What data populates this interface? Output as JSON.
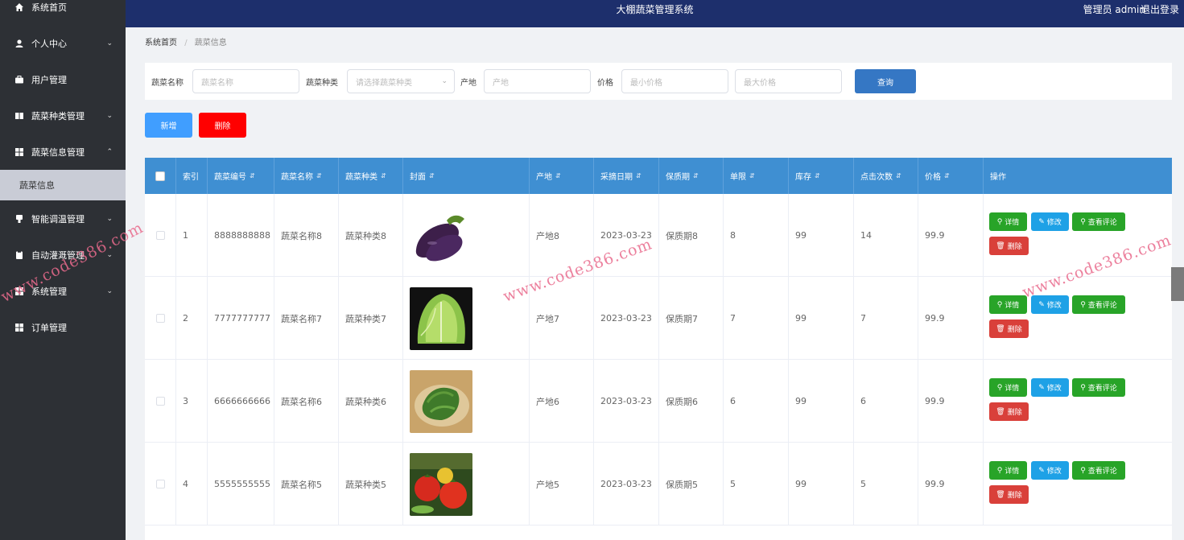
{
  "app": {
    "title": "大棚蔬菜管理系统",
    "user": "管理员 admin",
    "logout": "退出登录"
  },
  "sidebar": {
    "items": [
      {
        "label": "系统首页",
        "icon": "home-icon",
        "chevron": false
      },
      {
        "label": "个人中心",
        "icon": "user-icon",
        "chevron": true
      },
      {
        "label": "用户管理",
        "icon": "briefcase-icon",
        "chevron": false
      },
      {
        "label": "蔬菜种类管理",
        "icon": "book-icon",
        "chevron": true
      },
      {
        "label": "蔬菜信息管理",
        "icon": "grid-icon",
        "chevron": true,
        "expanded": true
      },
      {
        "label": "智能调温管理",
        "icon": "bulb-icon",
        "chevron": true
      },
      {
        "label": "自动灌溉管理",
        "icon": "clipboard-icon",
        "chevron": true
      },
      {
        "label": "系统管理",
        "icon": "grid-icon",
        "chevron": true
      },
      {
        "label": "订单管理",
        "icon": "grid-icon",
        "chevron": false
      }
    ],
    "submenu_active": "蔬菜信息"
  },
  "breadcrumb": {
    "home": "系统首页",
    "sep": "/",
    "current": "蔬菜信息"
  },
  "search": {
    "name_label": "蔬菜名称",
    "name_placeholder": "蔬菜名称",
    "type_label": "蔬菜种类",
    "type_placeholder": "请选择蔬菜种类",
    "origin_label": "产地",
    "origin_placeholder": "产地",
    "price_label": "价格",
    "min_placeholder": "最小价格",
    "max_placeholder": "最大价格",
    "query_button": "查询"
  },
  "actions": {
    "add": "新增",
    "delete": "删除"
  },
  "table": {
    "headers": [
      "索引",
      "蔬菜编号",
      "蔬菜名称",
      "蔬菜种类",
      "封面",
      "产地",
      "采摘日期",
      "保质期",
      "单限",
      "库存",
      "点击次数",
      "价格",
      "操作"
    ],
    "rows": [
      {
        "index": "1",
        "code": "8888888888",
        "name": "蔬菜名称8",
        "type": "蔬菜种类8",
        "cover": "eggplant",
        "origin": "产地8",
        "date": "2023-03-23",
        "shelf": "保质期8",
        "limit": "8",
        "stock": "99",
        "clicks": "14",
        "price": "99.9"
      },
      {
        "index": "2",
        "code": "7777777777",
        "name": "蔬菜名称7",
        "type": "蔬菜种类7",
        "cover": "lettuce",
        "origin": "产地7",
        "date": "2023-03-23",
        "shelf": "保质期7",
        "limit": "7",
        "stock": "99",
        "clicks": "7",
        "price": "99.9"
      },
      {
        "index": "3",
        "code": "6666666666",
        "name": "蔬菜名称6",
        "type": "蔬菜种类6",
        "cover": "spinach",
        "origin": "产地6",
        "date": "2023-03-23",
        "shelf": "保质期6",
        "limit": "6",
        "stock": "99",
        "clicks": "6",
        "price": "99.9"
      },
      {
        "index": "4",
        "code": "5555555555",
        "name": "蔬菜名称5",
        "type": "蔬菜种类5",
        "cover": "tomatoes",
        "origin": "产地5",
        "date": "2023-03-23",
        "shelf": "保质期5",
        "limit": "5",
        "stock": "99",
        "clicks": "5",
        "price": "99.9"
      }
    ],
    "ops": {
      "detail": "详情",
      "edit": "修改",
      "review": "查看评论",
      "remove": "删除"
    }
  },
  "watermark": "www.code386.com",
  "colors": {
    "topbar": "#1d2f6c",
    "sidebar": "#2d3035",
    "table_header": "#3f8fd2",
    "primary": "#409eff",
    "danger": "#ff0000",
    "success": "#28a428"
  }
}
